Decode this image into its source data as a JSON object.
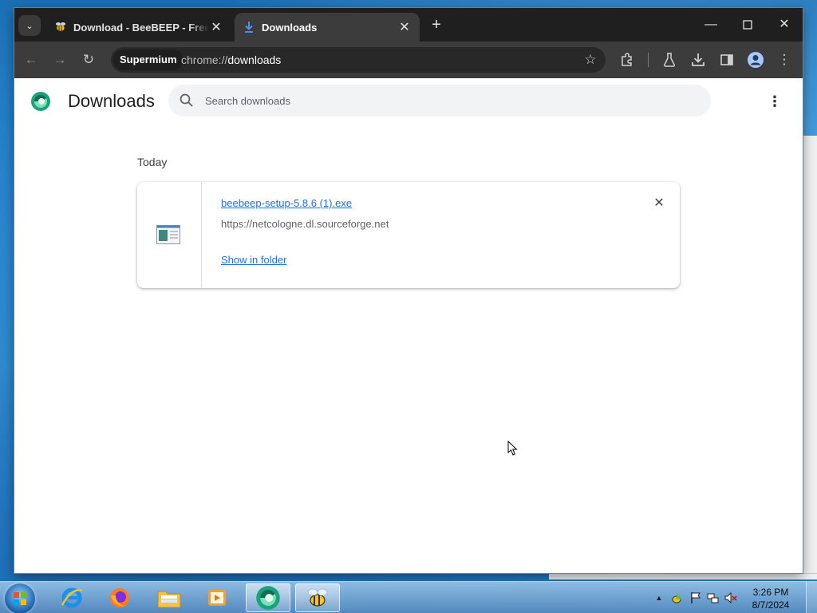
{
  "browser": {
    "tabs": [
      {
        "title": "Download - BeeBEEP - Free Of",
        "favicon": "beebeep-bee-icon"
      },
      {
        "title": "Downloads",
        "favicon": "download-icon",
        "active": true
      }
    ],
    "omnibox": {
      "chip_label": "Supermium",
      "url_scheme": "chrome://",
      "url_host": "downloads"
    }
  },
  "downloads_page": {
    "title": "Downloads",
    "search_placeholder": "Search downloads",
    "section_label": "Today",
    "items": [
      {
        "filename": "beebeep-setup-5.8.6 (1).exe",
        "source": "https://netcologne.dl.sourceforge.net",
        "action_label": "Show in folder"
      }
    ]
  },
  "taskbar": {
    "pinned": [
      "internet-explorer-icon",
      "firefox-icon",
      "file-explorer-icon",
      "media-player-icon",
      "supermium-icon",
      "beebeep-icon"
    ],
    "clock_time": "3:26 PM",
    "clock_date": "8/7/2024"
  },
  "colors": {
    "accent_link": "#1a73e8",
    "tabstrip_bg": "#1f1f1f",
    "toolbar_bg": "#3c3c3c"
  }
}
